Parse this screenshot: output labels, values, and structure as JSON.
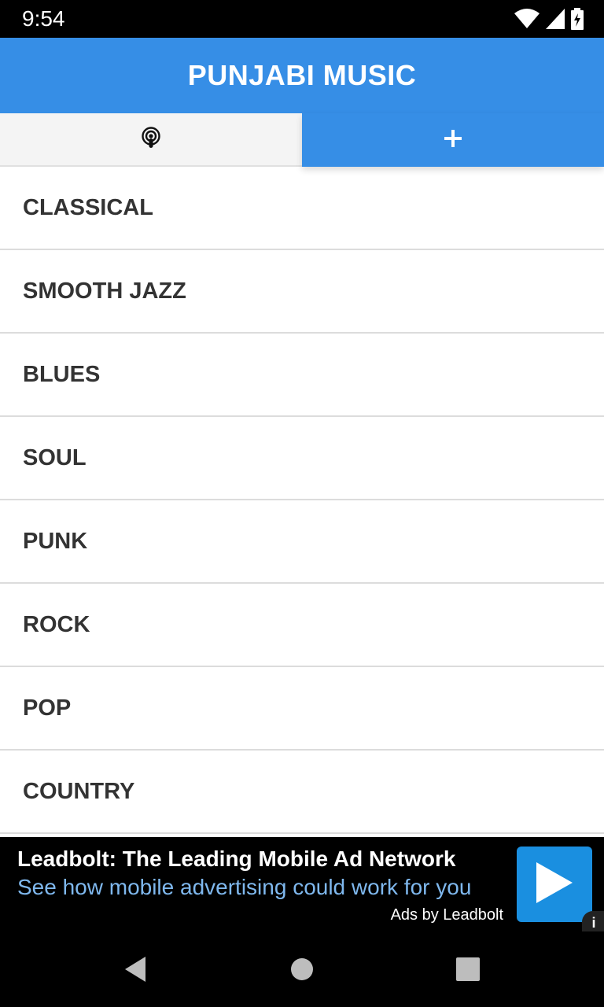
{
  "status_bar": {
    "time": "9:54"
  },
  "app_bar": {
    "title": "PUNJABI MUSIC",
    "color": "#368ee6"
  },
  "tabs": [
    {
      "icon": "podcast-icon"
    },
    {
      "icon": "plus-icon",
      "label": "+"
    }
  ],
  "genres": [
    {
      "label": "CLASSICAL"
    },
    {
      "label": "SMOOTH JAZZ"
    },
    {
      "label": "BLUES"
    },
    {
      "label": "SOUL"
    },
    {
      "label": "PUNK"
    },
    {
      "label": "ROCK"
    },
    {
      "label": "POP"
    },
    {
      "label": "COUNTRY"
    }
  ],
  "ad": {
    "title": "Leadbolt: The Leading Mobile Ad Network",
    "subtitle": "See how mobile advertising could work for you",
    "attribution": "Ads by Leadbolt",
    "info_label": "i"
  }
}
